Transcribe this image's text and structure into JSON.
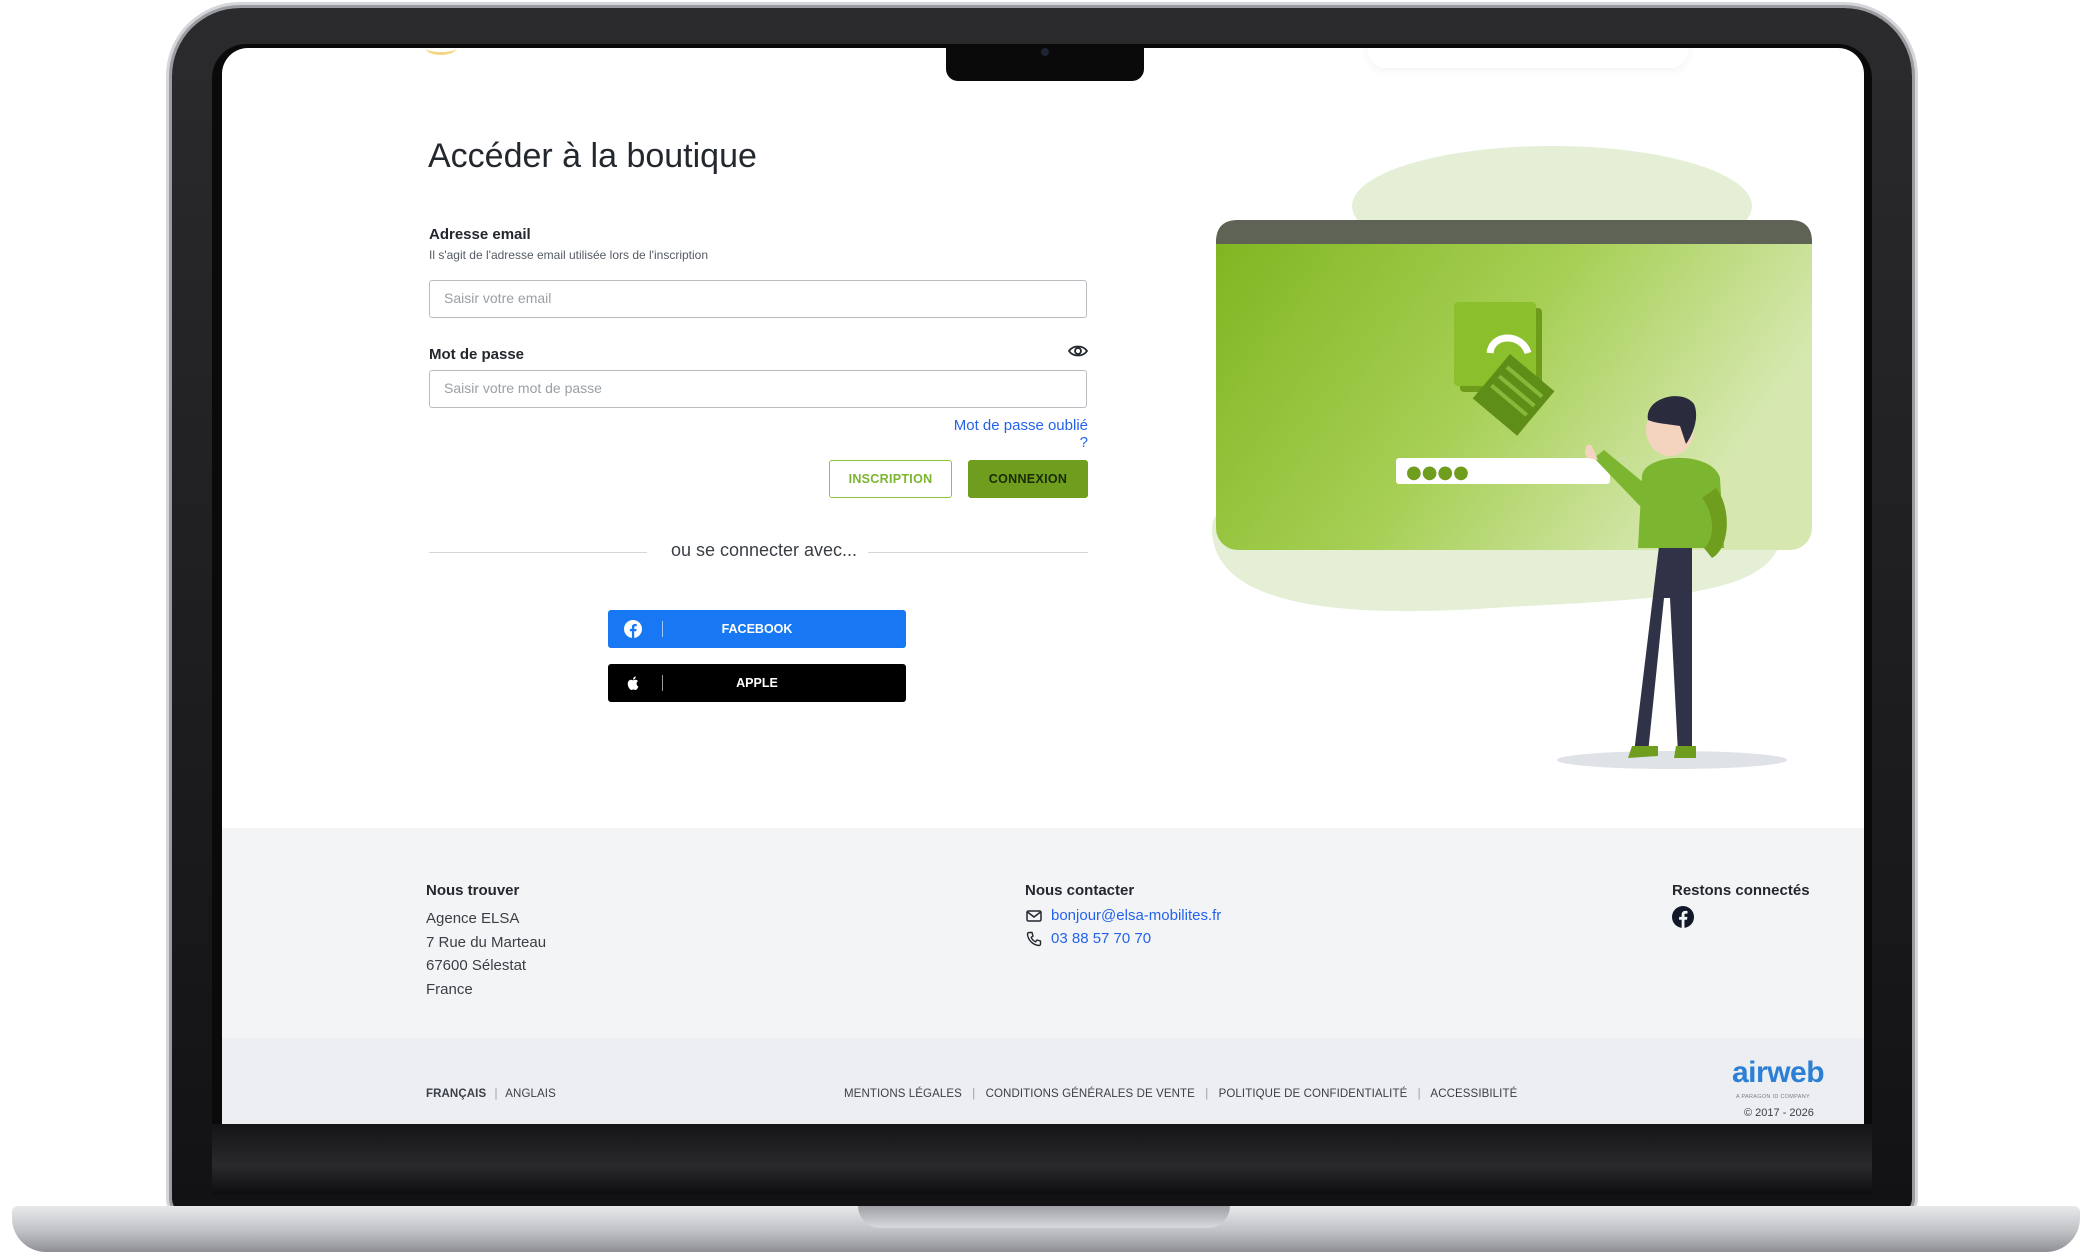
{
  "login": {
    "title": "Accéder à la boutique",
    "email_label": "Adresse email",
    "email_hint": "Il s'agit de l'adresse email utilisée lors de l'inscription",
    "email_placeholder": "Saisir votre email",
    "email_value": "",
    "password_label": "Mot de passe",
    "password_placeholder": "Saisir votre mot de passe",
    "password_value": "",
    "forgot_link": "Mot de passe oublié ?",
    "signup_button": "INSCRIPTION",
    "login_button": "CONNEXION",
    "divider_text": "ou se connecter avec...",
    "facebook_button": "FACEBOOK",
    "apple_button": "APPLE"
  },
  "illustration": {
    "password_mask": "●●●●"
  },
  "footer": {
    "find_us_title": "Nous trouver",
    "address": [
      "Agence ELSA",
      "7 Rue du Marteau",
      "67600 Sélestat",
      "France"
    ],
    "contact_title": "Nous contacter",
    "email": "bonjour@elsa-mobilites.fr",
    "phone": "03 88 57 70 70",
    "social_title": "Restons connectés",
    "languages": {
      "current": "FRANÇAIS",
      "separator": "|",
      "other": "ANGLAIS"
    },
    "legal_links": [
      "MENTIONS LÉGALES",
      "CONDITIONS GÉNÉRALES DE VENTE",
      "POLITIQUE DE CONFIDENTIALITÉ",
      "ACCESSIBILITÉ"
    ],
    "legal_separator": "|",
    "brand": "airweb",
    "brand_tagline": "A PARAGON ID COMPANY",
    "copyright": "© 2017 - 2026"
  },
  "colors": {
    "accent_green": "#6f9e1e",
    "facebook_blue": "#1877f2",
    "apple_black": "#000000",
    "link_blue": "#2563eb",
    "brand_blue": "#2b7fd4"
  },
  "icons": {
    "password_toggle": "eye-icon",
    "facebook": "facebook-icon",
    "apple": "apple-icon",
    "mail": "mail-icon",
    "phone": "phone-icon",
    "footer_social": "facebook-icon"
  }
}
